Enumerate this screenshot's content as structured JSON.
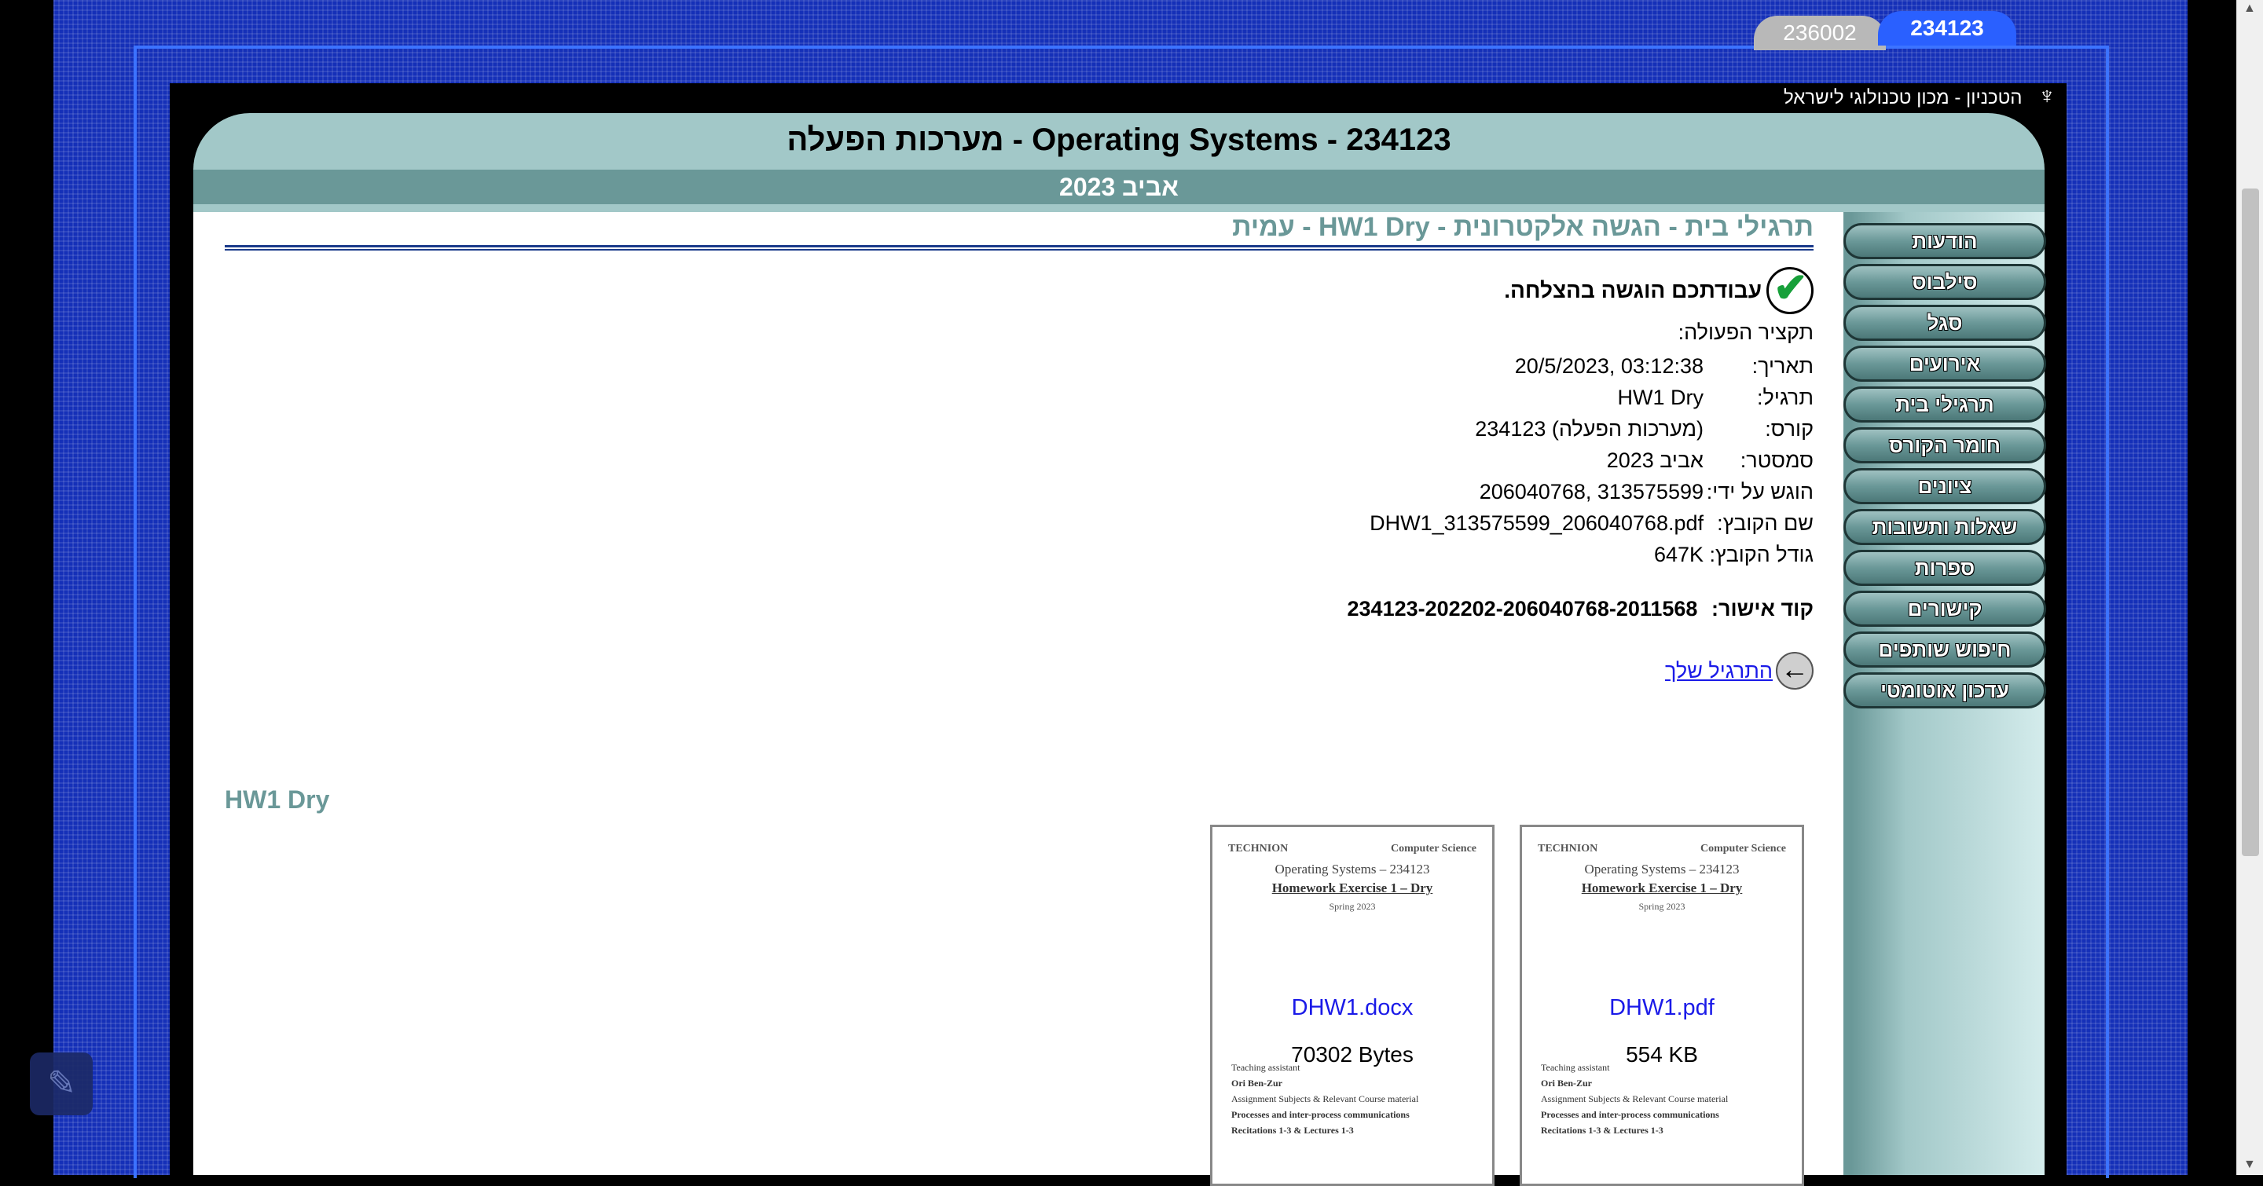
{
  "tabs": [
    "236002",
    "234123"
  ],
  "institute": "הטכניון - מכון טכנולוגי לישראל",
  "course": {
    "title": "234123 - Operating Systems - מערכות הפעלה",
    "semester": "אביב 2023"
  },
  "page_heading": "תרגילי בית - הגשה אלקטרונית - HW1 Dry - עמית",
  "success_message": "עבודתכם הוגשה בהצלחה.",
  "summary_title": "תקציר הפעולה:",
  "details": [
    {
      "label": "תאריך:",
      "value": "20/5/2023, 03:12:38"
    },
    {
      "label": "תרגיל:",
      "value": "HW1 Dry"
    },
    {
      "label": "קורס:",
      "value": "234123 (מערכות הפעלה)"
    },
    {
      "label": "סמסטר:",
      "value": "אביב 2023"
    },
    {
      "label": "הוגש על ידי:",
      "value": "206040768, 313575599"
    },
    {
      "label": "שם הקובץ:",
      "value": "DHW1_313575599_206040768.pdf"
    },
    {
      "label": "גודל הקובץ:",
      "value": "647K"
    }
  ],
  "approval": {
    "label": "קוד אישור:",
    "value": "234123-202202-206040768-2011568"
  },
  "back_link": "התרגיל שלך",
  "nav": [
    "הודעות",
    "סילבוס",
    "סגל",
    "אירועים",
    "תרגילי בית",
    "חומר הקורס",
    "ציונים",
    "שאלות ותשובות",
    "ספרות",
    "קישורים",
    "חיפוש שותפים",
    "עדכון אוטומטי"
  ],
  "hw_label": "HW1 Dry",
  "files": [
    {
      "name": "DHW1.pdf",
      "size": "554 KB"
    },
    {
      "name": "DHW1.docx",
      "size": "70302 Bytes"
    }
  ],
  "thumb": {
    "logo_left": "TECHNION",
    "logo_right": "Computer Science",
    "line1": "Operating Systems – 234123",
    "line2": "Homework Exercise 1 – Dry",
    "line3": "Spring 2023",
    "lower1": "Teaching assistant",
    "lower2": "Ori Ben-Zur",
    "lower3": "Assignment Subjects & Relevant Course material",
    "lower4": "Processes and inter-process communications",
    "lower5": "Recitations 1-3 & Lectures 1-3"
  }
}
